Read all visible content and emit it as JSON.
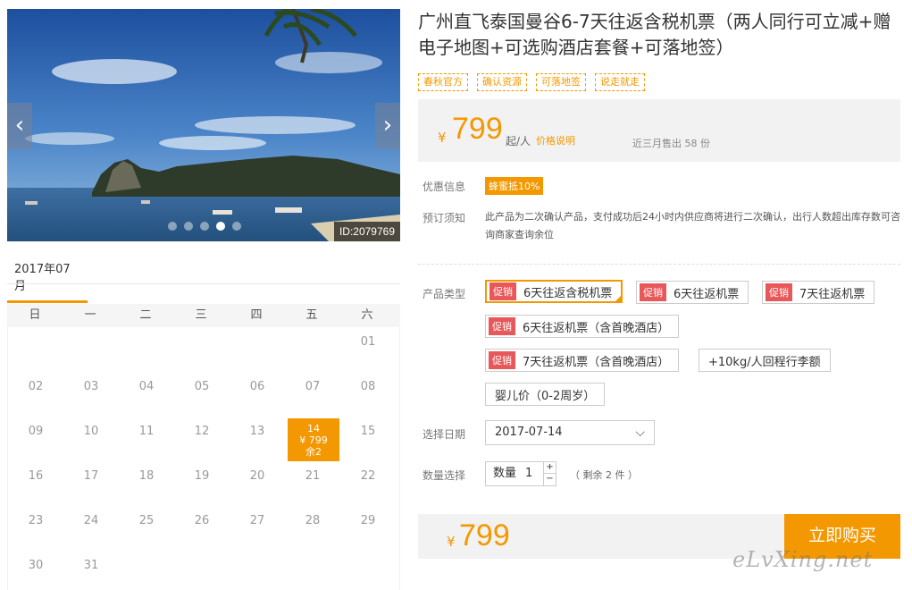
{
  "gallery": {
    "image_id": "ID:2079769",
    "prev_arrow": "‹",
    "next_arrow": "›",
    "slide_count": 5,
    "active_slide": 4
  },
  "calendar": {
    "month_label": "2017年07月",
    "weekdays": [
      "日",
      "一",
      "二",
      "三",
      "四",
      "五",
      "六"
    ],
    "days": [
      "01",
      "02",
      "03",
      "04",
      "05",
      "06",
      "07",
      "08",
      "09",
      "10",
      "11",
      "12",
      "13",
      "14",
      "15",
      "16",
      "17",
      "18",
      "19",
      "20",
      "21",
      "22",
      "23",
      "24",
      "25",
      "26",
      "27",
      "28",
      "29",
      "30",
      "31"
    ],
    "selected": {
      "day": "14",
      "price": "¥ 799",
      "remain": "余2"
    }
  },
  "product": {
    "title": "广州直飞泰国曼谷6-7天往返含税机票（两人同行可立减+赠电子地图+可选购酒店套餐+可落地签）",
    "tags": [
      "春秋官方",
      "确认资源",
      "可落地签",
      "说走就走"
    ]
  },
  "price": {
    "yen": "¥",
    "amount": "799",
    "unit": "起/人",
    "note_link": "价格说明",
    "sold": "近三月售出 58 份"
  },
  "promo": {
    "label": "优惠信息",
    "badge": "蜂蜜抵10%"
  },
  "booking_notice": {
    "label": "预订须知",
    "text": "此产品为二次确认产品，支付成功后24小时内供应商将进行二次确认，出行人数超出库存数可咨询商家查询余位"
  },
  "options": {
    "label": "产品类型",
    "sale_tag": "促销",
    "items": [
      {
        "text": "6天往返含税机票"
      },
      {
        "text": "6天往返机票"
      },
      {
        "text": "7天往返机票"
      },
      {
        "text": "6天往返机票（含首晚酒店）"
      },
      {
        "text": "7天往返机票（含首晚酒店）"
      },
      {
        "text": "+10kg/人回程行李额"
      },
      {
        "text": "婴儿价（0-2周岁）"
      }
    ]
  },
  "date": {
    "label": "选择日期",
    "value": "2017-07-14",
    "chevron": "⌵"
  },
  "quantity": {
    "label": "数量选择",
    "field_label": "数量",
    "value": "1",
    "plus": "+",
    "minus": "−",
    "stock": "（ 剩余 2 件 ）"
  },
  "bottom": {
    "yen": "¥",
    "amount": "799",
    "buy_label": "立即购买"
  },
  "watermark": "eLvXing.net",
  "colors": {
    "accent": "#f39800",
    "sale": "#e8585a"
  }
}
